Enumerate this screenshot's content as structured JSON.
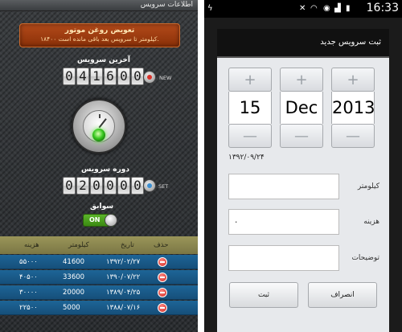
{
  "left": {
    "title": "اطلاعات سرویس",
    "warning": {
      "title": "تعویض روغن موتور",
      "text": "۱۸۴۰۰ کیلومتر تا سرویس بعد باقی مانده است."
    },
    "last_service": {
      "label": "آخرین سرویس",
      "digits": [
        "0",
        "4",
        "1",
        "6",
        "0",
        "0"
      ],
      "button_label": "NEW"
    },
    "service_period": {
      "label": "دوره سرویس",
      "digits": [
        "0",
        "2",
        "0",
        "0",
        "0",
        "0"
      ],
      "button_label": "SET"
    },
    "history": {
      "label": "سوابق",
      "toggle": "ON"
    },
    "table": {
      "headers": {
        "delete": "حذف",
        "date": "تاریخ",
        "km": "کیلومتر",
        "cost": "هزینه"
      },
      "rows": [
        {
          "date": "۱۳۹۲/۰۲/۲۷",
          "km": "41600",
          "cost": "۵۵۰۰۰"
        },
        {
          "date": "۱۳۹۰/۰۷/۲۲",
          "km": "33600",
          "cost": "۴۰۵۰۰"
        },
        {
          "date": "۱۳۸۹/۰۴/۲۵",
          "km": "20000",
          "cost": "۳۰۰۰۰"
        },
        {
          "date": "۱۳۸۸/۰۷/۱۶",
          "km": "5000",
          "cost": "۲۲۵۰۰"
        }
      ]
    }
  },
  "right": {
    "status": {
      "time": "16:33"
    },
    "dialog_title": "ثبت سرویس جدید",
    "picker": {
      "day": "15",
      "month": "Dec",
      "year": "2013",
      "plus": "+",
      "minus": "—"
    },
    "hijri_date": "۱۳۹۲/۰۹/۲۴",
    "fields": {
      "km_label": "کیلومتر",
      "km_value": "",
      "cost_label": "هزینه",
      "cost_value": "۰",
      "notes_label": "توضیحات",
      "notes_value": ""
    },
    "buttons": {
      "save": "ثبت",
      "cancel": "انصراف"
    }
  }
}
